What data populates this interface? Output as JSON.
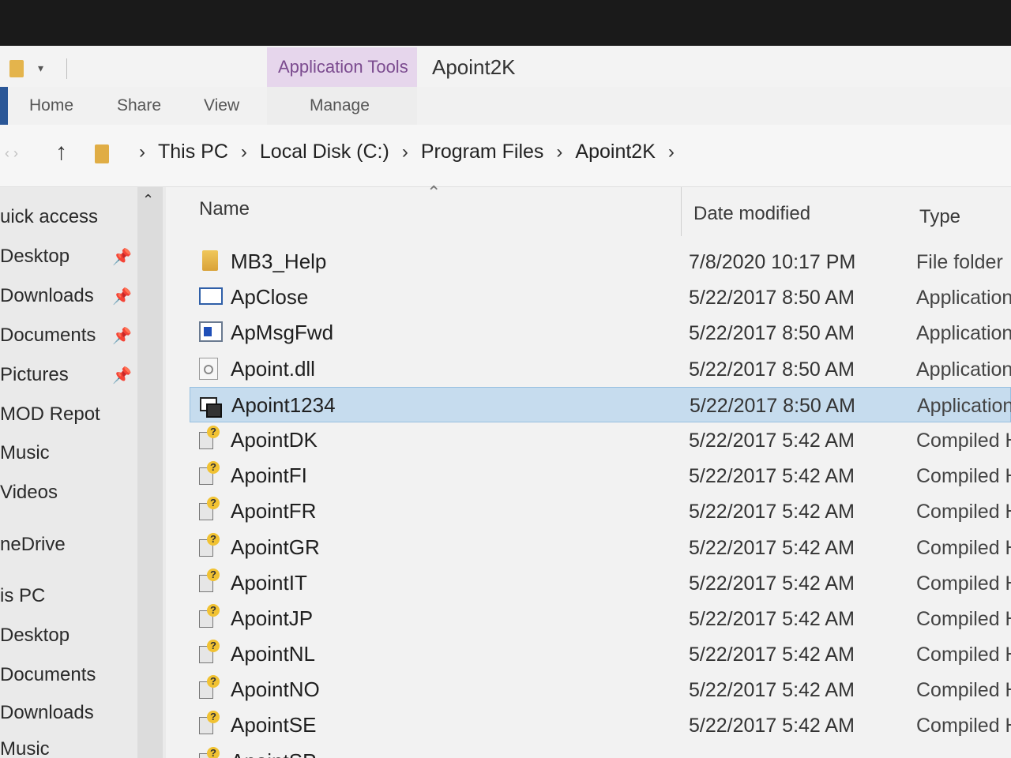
{
  "titlebar": {
    "context_tab": "Application Tools",
    "title": "Apoint2K"
  },
  "ribbon": {
    "tabs": [
      "Home",
      "Share",
      "View",
      "Manage"
    ]
  },
  "address": {
    "crumbs": [
      "This PC",
      "Local Disk (C:)",
      "Program Files",
      "Apoint2K"
    ]
  },
  "nav": {
    "items": [
      "uick access",
      "Desktop",
      "Downloads",
      "Documents",
      "Pictures",
      "MOD Repot",
      "Music",
      "Videos",
      "neDrive",
      "is PC",
      "Desktop",
      "Documents",
      "Downloads",
      "Music"
    ]
  },
  "columns": {
    "name": "Name",
    "date": "Date modified",
    "type": "Type"
  },
  "files": [
    {
      "name": "MB3_Help",
      "date": "7/8/2020 10:17 PM",
      "type": "File folder",
      "icon": "folder-icon"
    },
    {
      "name": "ApClose",
      "date": "5/22/2017 8:50 AM",
      "type": "Application",
      "icon": "window-app-icon"
    },
    {
      "name": "ApMsgFwd",
      "date": "5/22/2017 8:50 AM",
      "type": "Application",
      "icon": "blue-app-icon"
    },
    {
      "name": "Apoint.dll",
      "date": "5/22/2017 8:50 AM",
      "type": "Application",
      "icon": "dll-file-icon"
    },
    {
      "name": "Apoint1234",
      "date": "5/22/2017 8:50 AM",
      "type": "Application",
      "icon": "application-icon"
    },
    {
      "name": "ApointDK",
      "date": "5/22/2017 5:42 AM",
      "type": "Compiled H",
      "icon": "compiled-help-icon"
    },
    {
      "name": "ApointFI",
      "date": "5/22/2017 5:42 AM",
      "type": "Compiled H",
      "icon": "compiled-help-icon"
    },
    {
      "name": "ApointFR",
      "date": "5/22/2017 5:42 AM",
      "type": "Compiled H",
      "icon": "compiled-help-icon"
    },
    {
      "name": "ApointGR",
      "date": "5/22/2017 5:42 AM",
      "type": "Compiled H",
      "icon": "compiled-help-icon"
    },
    {
      "name": "ApointIT",
      "date": "5/22/2017 5:42 AM",
      "type": "Compiled H",
      "icon": "compiled-help-icon"
    },
    {
      "name": "ApointJP",
      "date": "5/22/2017 5:42 AM",
      "type": "Compiled H",
      "icon": "compiled-help-icon"
    },
    {
      "name": "ApointNL",
      "date": "5/22/2017 5:42 AM",
      "type": "Compiled H",
      "icon": "compiled-help-icon"
    },
    {
      "name": "ApointNO",
      "date": "5/22/2017 5:42 AM",
      "type": "Compiled H",
      "icon": "compiled-help-icon"
    },
    {
      "name": "ApointSE",
      "date": "5/22/2017 5:42 AM",
      "type": "Compiled H",
      "icon": "compiled-help-icon"
    },
    {
      "name": "ApointSP",
      "date": "",
      "type": "",
      "icon": "compiled-help-icon"
    }
  ],
  "selected_index": 4,
  "colors": {
    "selection": "#c6dcee",
    "context_tab": "#e6d6ec",
    "folder": "#e4b44c"
  }
}
